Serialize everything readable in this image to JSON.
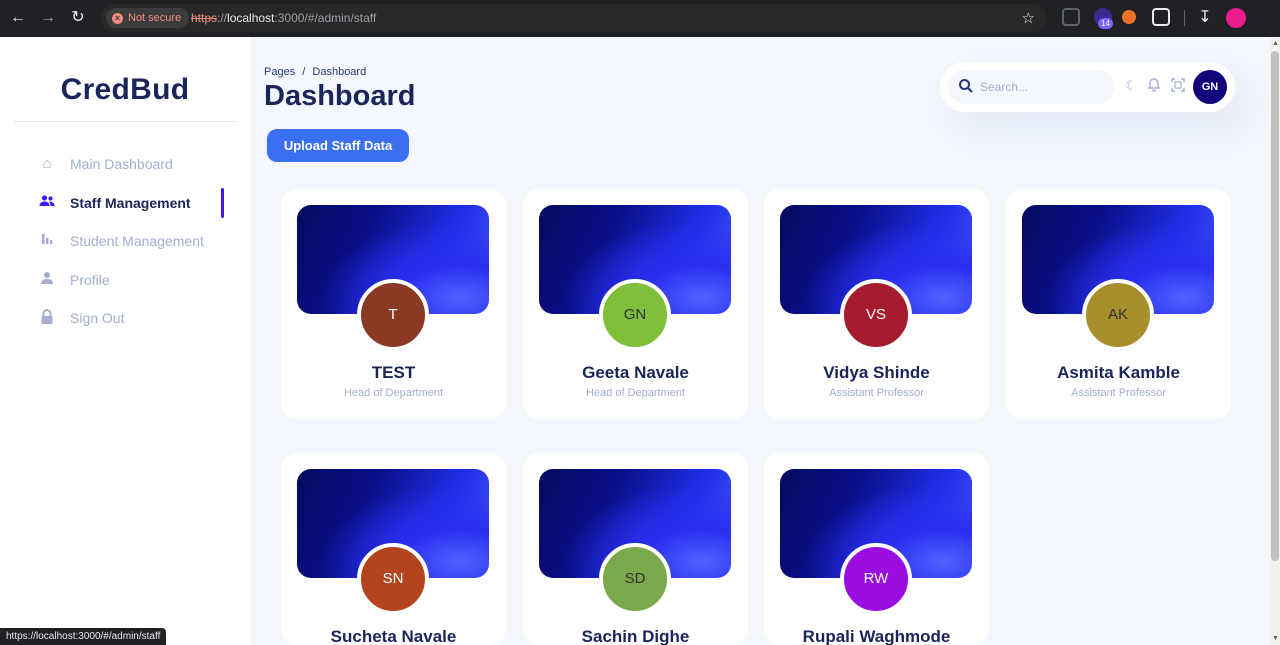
{
  "browser": {
    "security_label": "Not secure",
    "url_protocol": "https",
    "url_sep": "://",
    "url_host": "localhost",
    "url_path": ":3000/#/admin/staff",
    "extension_badge": "14",
    "status_url": "https://localhost:3000/#/admin/staff"
  },
  "sidebar": {
    "logo": "CredBud",
    "items": [
      {
        "label": "Main Dashboard",
        "icon": "home-icon"
      },
      {
        "label": "Staff Management",
        "icon": "people-icon",
        "active": true
      },
      {
        "label": "Student Management",
        "icon": "bar-chart-icon"
      },
      {
        "label": "Profile",
        "icon": "person-icon"
      },
      {
        "label": "Sign Out",
        "icon": "lock-icon"
      }
    ]
  },
  "header": {
    "breadcrumb_root": "Pages",
    "breadcrumb_sep": "/",
    "breadcrumb_current": "Dashboard",
    "title": "Dashboard"
  },
  "topbar": {
    "search_placeholder": "Search...",
    "avatar_initials": "GN"
  },
  "actions": {
    "upload_label": "Upload Staff Data"
  },
  "staff": [
    {
      "initials": "T",
      "name": "TEST",
      "role": "Head of Department",
      "color": "#8b3a26",
      "text_color": "#ffffff"
    },
    {
      "initials": "GN",
      "name": "Geeta Navale",
      "role": "Head of Department",
      "color": "#7fbf3a",
      "text_color": "#333333"
    },
    {
      "initials": "VS",
      "name": "Vidya Shinde",
      "role": "Assistant Professor",
      "color": "#a51c2f",
      "text_color": "#ffffff"
    },
    {
      "initials": "AK",
      "name": "Asmita Kamble",
      "role": "Assistant Professor",
      "color": "#a88e2c",
      "text_color": "#333333"
    },
    {
      "initials": "SN",
      "name": "Sucheta Navale",
      "role": "",
      "color": "#b3441e",
      "text_color": "#ffffff"
    },
    {
      "initials": "SD",
      "name": "Sachin Dighe",
      "role": "",
      "color": "#7ba84b",
      "text_color": "#333333"
    },
    {
      "initials": "RW",
      "name": "Rupali Waghmode",
      "role": "",
      "color": "#9b0ee0",
      "text_color": "#ffffff"
    }
  ]
}
